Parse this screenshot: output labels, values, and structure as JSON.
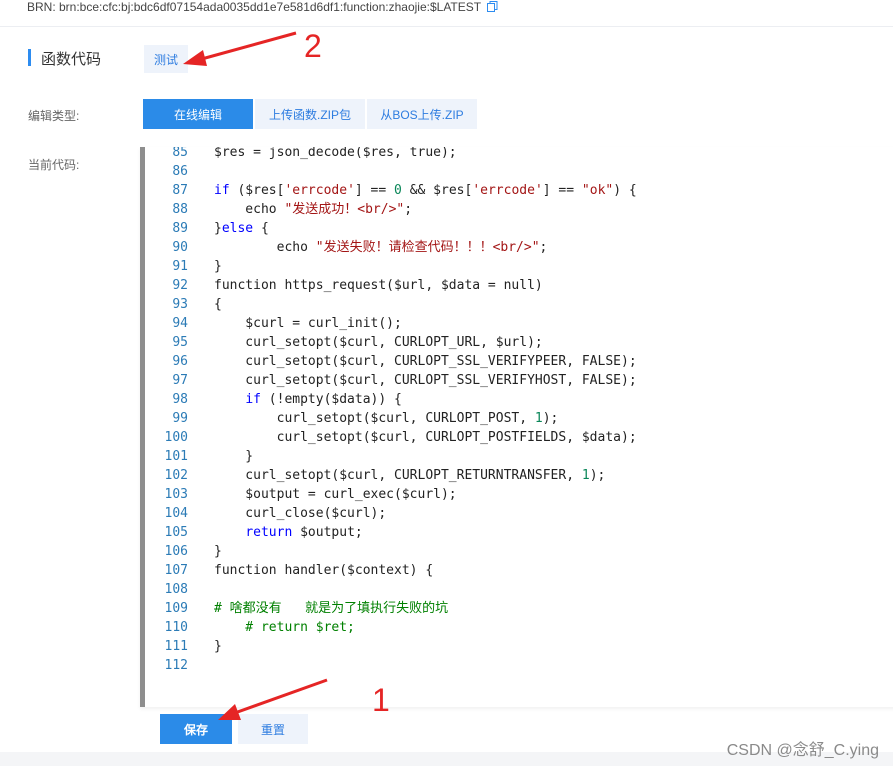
{
  "brn": {
    "text": "BRN:  brn:bce:cfc:bj:bdc6df07154ada0035dd1e7e581d6df1:function:zhaojie:$LATEST"
  },
  "section": {
    "title": "函数代码",
    "test_label": "测试"
  },
  "edit_type": {
    "label": "编辑类型:",
    "tabs": [
      "在线编辑",
      "上传函数.ZIP包",
      "从BOS上传.ZIP"
    ],
    "active": 0
  },
  "current_code": {
    "label": "当前代码:"
  },
  "code_lines": [
    {
      "n": "85",
      "t": "$res = json_decode($res, true);"
    },
    {
      "n": "86",
      "t": ""
    },
    {
      "n": "87",
      "t": "if ($res['errcode'] == 0 && $res['errcode'] == \"ok\") {"
    },
    {
      "n": "88",
      "t": "    echo \"发送成功！<br/>\";"
    },
    {
      "n": "89",
      "t": "}else {"
    },
    {
      "n": "90",
      "t": "        echo \"发送失败！请检查代码！！！<br/>\";"
    },
    {
      "n": "91",
      "t": "}"
    },
    {
      "n": "92",
      "t": "function https_request($url, $data = null)"
    },
    {
      "n": "93",
      "t": "{"
    },
    {
      "n": "94",
      "t": "    $curl = curl_init();"
    },
    {
      "n": "95",
      "t": "    curl_setopt($curl, CURLOPT_URL, $url);"
    },
    {
      "n": "96",
      "t": "    curl_setopt($curl, CURLOPT_SSL_VERIFYPEER, FALSE);"
    },
    {
      "n": "97",
      "t": "    curl_setopt($curl, CURLOPT_SSL_VERIFYHOST, FALSE);"
    },
    {
      "n": "98",
      "t": "    if (!empty($data)) {"
    },
    {
      "n": "99",
      "t": "        curl_setopt($curl, CURLOPT_POST, 1);"
    },
    {
      "n": "100",
      "t": "        curl_setopt($curl, CURLOPT_POSTFIELDS, $data);"
    },
    {
      "n": "101",
      "t": "    }"
    },
    {
      "n": "102",
      "t": "    curl_setopt($curl, CURLOPT_RETURNTRANSFER, 1);"
    },
    {
      "n": "103",
      "t": "    $output = curl_exec($curl);"
    },
    {
      "n": "104",
      "t": "    curl_close($curl);"
    },
    {
      "n": "105",
      "t": "    return $output;"
    },
    {
      "n": "106",
      "t": "}"
    },
    {
      "n": "107",
      "t": "function handler($context) {"
    },
    {
      "n": "108",
      "t": ""
    },
    {
      "n": "109",
      "t": "# 啥都没有   就是为了填执行失败的坑"
    },
    {
      "n": "110",
      "t": "    # return $ret;"
    },
    {
      "n": "111",
      "t": "}"
    },
    {
      "n": "112",
      "t": ""
    }
  ],
  "buttons": {
    "save": "保存",
    "reset": "重置"
  },
  "annotations": {
    "one": "1",
    "two": "2"
  },
  "watermark": "CSDN @念舒_C.ying",
  "colors": {
    "accent": "#2b8be8",
    "arrow": "#e52525"
  },
  "icons": {
    "copy": "copy-icon"
  }
}
